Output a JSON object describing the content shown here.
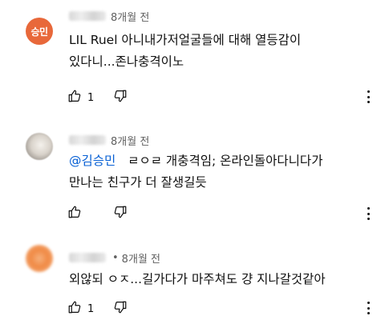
{
  "comments": [
    {
      "avatar_initial": "승민",
      "avatar_color": "#e8683a",
      "time": "8개월 전",
      "lines": [
        "LIL Ruel 아니내가저얼굴들에 대해 열등감이",
        "있다니...존나충격이노"
      ],
      "likes": "1"
    },
    {
      "time": "8개월 전",
      "mention": "@김승민",
      "lines": [
        "ㄹㅇㄹ 개충격임; 온라인돌아다니다가",
        "만나는 친구가 더 잘생길듯"
      ],
      "likes": ""
    },
    {
      "dot": "•",
      "time": "8개월 전",
      "lines": [
        "외않되 ㅇㅈ...길가다가 마주쳐도 걍 지나갈것같아"
      ],
      "likes": "1"
    }
  ],
  "icons": {
    "like": "thumb-up-icon",
    "dislike": "thumb-down-icon",
    "more": "more-vert-icon"
  },
  "colors": {
    "mention": "#065fd4",
    "meta": "#606060",
    "text": "#0f0f0f"
  }
}
